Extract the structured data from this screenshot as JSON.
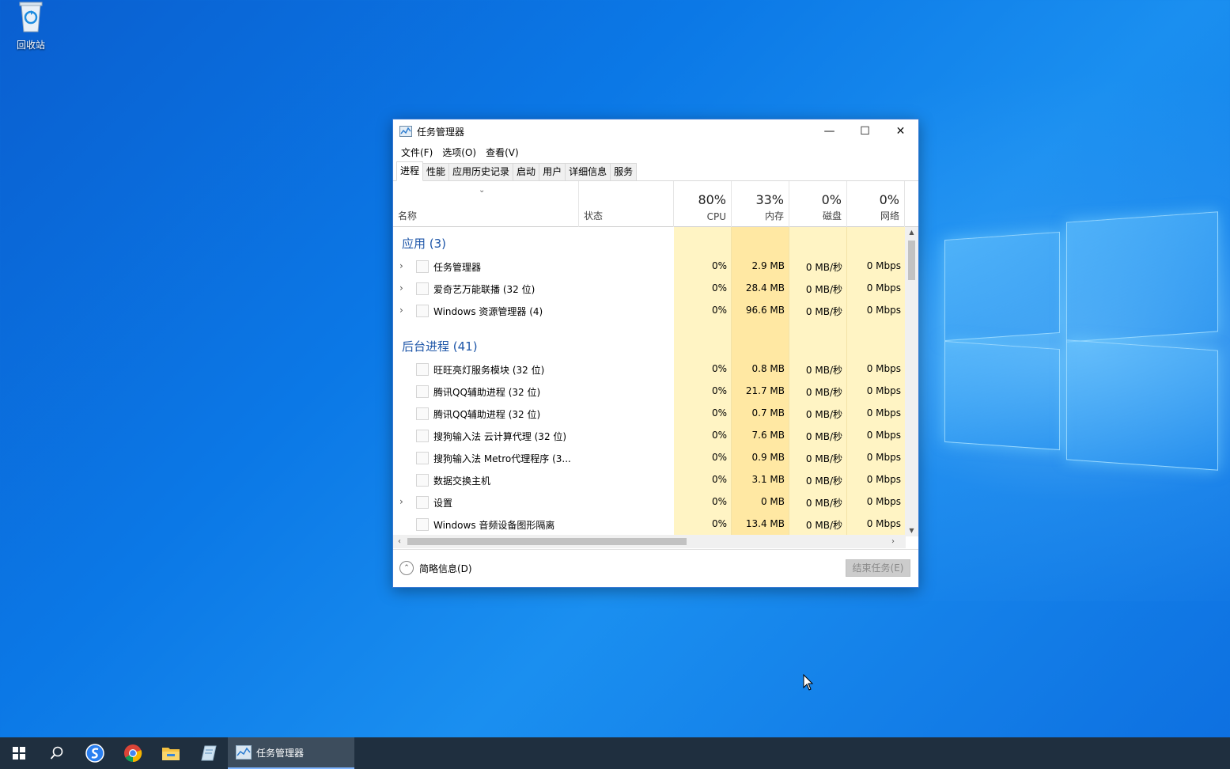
{
  "desktop": {
    "recycle_bin_label": "回收站"
  },
  "window": {
    "title": "任务管理器",
    "controls": {
      "minimize": "—",
      "maximize": "☐",
      "close": "✕"
    }
  },
  "menu": [
    "文件(F)",
    "选项(O)",
    "查看(V)"
  ],
  "tabs": [
    "进程",
    "性能",
    "应用历史记录",
    "启动",
    "用户",
    "详细信息",
    "服务"
  ],
  "active_tab": "进程",
  "columns": {
    "name": "名称",
    "status": "状态",
    "cpu": {
      "pct": "80%",
      "label": "CPU"
    },
    "memory": {
      "pct": "33%",
      "label": "内存"
    },
    "disk": {
      "pct": "0%",
      "label": "磁盘"
    },
    "network": {
      "pct": "0%",
      "label": "网络"
    }
  },
  "groups": [
    {
      "title": "应用 (3)",
      "rows": [
        {
          "name": "任务管理器",
          "expandable": true,
          "cpu": "0%",
          "mem": "2.9 MB",
          "disk": "0 MB/秒",
          "net": "0 Mbps"
        },
        {
          "name": "爱奇艺万能联播 (32 位)",
          "expandable": true,
          "cpu": "0%",
          "mem": "28.4 MB",
          "disk": "0 MB/秒",
          "net": "0 Mbps"
        },
        {
          "name": "Windows 资源管理器 (4)",
          "expandable": true,
          "cpu": "0%",
          "mem": "96.6 MB",
          "disk": "0 MB/秒",
          "net": "0 Mbps"
        }
      ]
    },
    {
      "title": "后台进程 (41)",
      "rows": [
        {
          "name": "旺旺亮灯服务模块 (32 位)",
          "expandable": false,
          "cpu": "0%",
          "mem": "0.8 MB",
          "disk": "0 MB/秒",
          "net": "0 Mbps"
        },
        {
          "name": "腾讯QQ辅助进程 (32 位)",
          "expandable": false,
          "cpu": "0%",
          "mem": "21.7 MB",
          "disk": "0 MB/秒",
          "net": "0 Mbps"
        },
        {
          "name": "腾讯QQ辅助进程 (32 位)",
          "expandable": false,
          "cpu": "0%",
          "mem": "0.7 MB",
          "disk": "0 MB/秒",
          "net": "0 Mbps"
        },
        {
          "name": "搜狗输入法 云计算代理 (32 位)",
          "expandable": false,
          "cpu": "0%",
          "mem": "7.6 MB",
          "disk": "0 MB/秒",
          "net": "0 Mbps"
        },
        {
          "name": "搜狗输入法 Metro代理程序 (3...",
          "expandable": false,
          "cpu": "0%",
          "mem": "0.9 MB",
          "disk": "0 MB/秒",
          "net": "0 Mbps"
        },
        {
          "name": "数据交换主机",
          "expandable": false,
          "cpu": "0%",
          "mem": "3.1 MB",
          "disk": "0 MB/秒",
          "net": "0 Mbps"
        },
        {
          "name": "设置",
          "expandable": true,
          "cpu": "0%",
          "mem": "0 MB",
          "disk": "0 MB/秒",
          "net": "0 Mbps"
        },
        {
          "name": "Windows 音频设备图形隔离",
          "expandable": false,
          "cpu": "0%",
          "mem": "13.4 MB",
          "disk": "0 MB/秒",
          "net": "0 Mbps"
        }
      ]
    }
  ],
  "footer": {
    "fewer_details": "简略信息(D)",
    "end_task": "结束任务(E)"
  },
  "taskbar": {
    "active_app": "任务管理器"
  },
  "colors": {
    "heat_light": "#fff4c4",
    "heat_mid": "#ffe8a3",
    "group_title": "#1e56a8",
    "taskbar": "#1f2f3f"
  }
}
